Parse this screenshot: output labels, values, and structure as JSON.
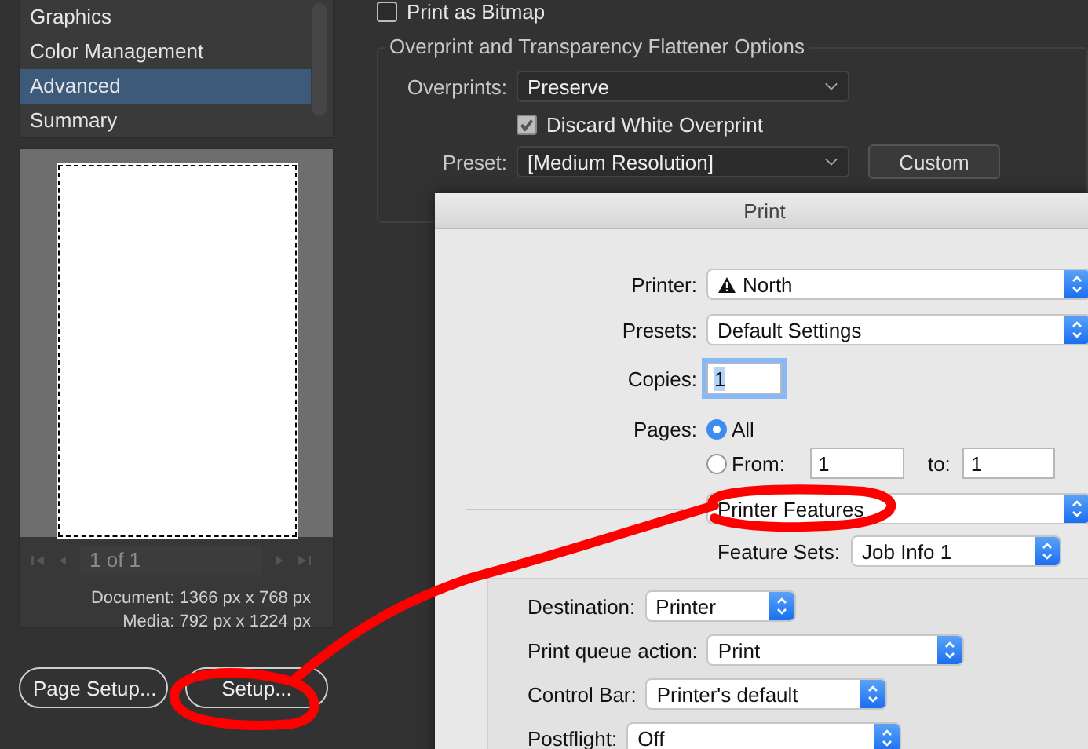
{
  "sidebar": {
    "items": [
      {
        "label": "Graphics",
        "selected": false
      },
      {
        "label": "Color Management",
        "selected": false
      },
      {
        "label": "Advanced",
        "selected": true
      },
      {
        "label": "Summary",
        "selected": false
      }
    ]
  },
  "preview": {
    "page_field": "1 of 1",
    "document": "Document: 1366 px x 768 px",
    "media": "Media: 792 px x 1224 px"
  },
  "buttons": [
    "Page Setup...",
    "Setup..."
  ],
  "options": {
    "print_as_bitmap": {
      "label": "Print as Bitmap",
      "checked": false
    },
    "group_title": "Overprint and Transparency Flattener Options",
    "overprints": {
      "label": "Overprints:",
      "value": "Preserve"
    },
    "discard_white": {
      "label": "Discard White Overprint",
      "checked": true
    },
    "preset": {
      "label": "Preset:",
      "value": "[Medium Resolution]"
    },
    "custom_button": "Custom"
  },
  "print_dialog": {
    "title": "Print",
    "printer": {
      "label": "Printer:",
      "value": "North"
    },
    "presets": {
      "label": "Presets:",
      "value": "Default Settings"
    },
    "copies": {
      "label": "Copies:",
      "value": "1"
    },
    "pages": {
      "label": "Pages:",
      "options": [
        {
          "label": "All",
          "selected": true
        },
        {
          "label": "From:",
          "selected": false
        }
      ],
      "from": "1",
      "to_label": "to:",
      "to": "1"
    },
    "section": "Printer Features",
    "feature_sets": {
      "label": "Feature Sets:",
      "value": "Job Info 1"
    },
    "settings": [
      {
        "label": "Destination:",
        "value": "Printer"
      },
      {
        "label": "Print queue action:",
        "value": "Print"
      },
      {
        "label": "Control Bar:",
        "value": "Printer's default"
      },
      {
        "label": "Postflight:",
        "value": "Off"
      }
    ]
  }
}
